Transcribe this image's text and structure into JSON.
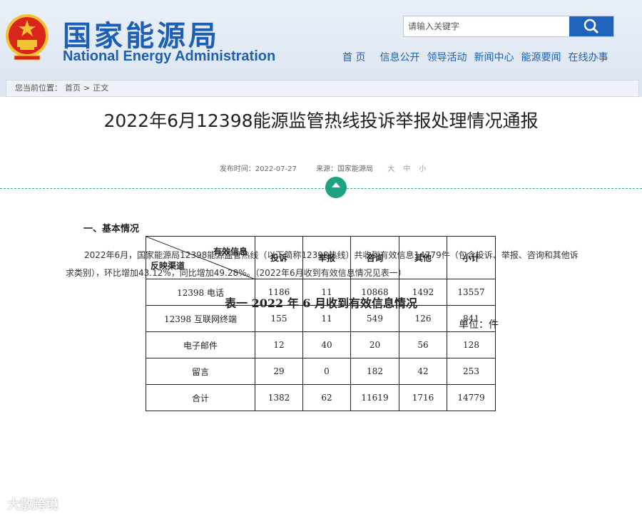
{
  "header": {
    "site_title": "国家能源局",
    "site_subtitle": "National Energy Administration",
    "search_placeholder": "请输入关键字",
    "nav": [
      "首 页",
      "信息公开",
      "领导活动",
      "新闻中心",
      "能源要闻",
      "在线办事"
    ]
  },
  "breadcrumb": {
    "label": "您当前位置：",
    "items": [
      "首页",
      "正文"
    ],
    "separator": ">"
  },
  "article": {
    "title": "2022年6月12398能源监管热线投诉举报处理情况通报",
    "publish_label": "发布时间：2022-07-27",
    "source_label": "来源：国家能源局",
    "size_options": [
      "大",
      "中",
      "小"
    ],
    "section_heading": "一、基本情况",
    "paragraph": "2022年6月，国家能源局12398能源监管热线（以下简称12398热线）共收到有效信息14779件（包含投诉、举报、咨询和其他诉求类别），环比增加43.12%，同比增加49.28%。（2022年6月收到有效信息情况见表一）",
    "table_caption": "表一  2022 年 6 月收到有效信息情况",
    "unit": "单位：件"
  },
  "table": {
    "header_diag_top": "有效信息",
    "header_diag_bottom": "反映渠道",
    "columns": [
      "投诉",
      "举报",
      "咨询",
      "其他",
      "小计"
    ],
    "rows": [
      {
        "channel": "12398 电话",
        "values": [
          "1186",
          "11",
          "10868",
          "1492",
          "13557"
        ]
      },
      {
        "channel": "12398 互联网终端",
        "values": [
          "155",
          "11",
          "549",
          "126",
          "841"
        ]
      },
      {
        "channel": "电子邮件",
        "values": [
          "12",
          "40",
          "20",
          "56",
          "128"
        ]
      },
      {
        "channel": "留言",
        "values": [
          "29",
          "0",
          "182",
          "42",
          "253"
        ]
      },
      {
        "channel": "合计",
        "values": [
          "1382",
          "62",
          "11619",
          "1716",
          "14779"
        ]
      }
    ]
  },
  "watermark": "大散跨境",
  "colors": {
    "brand_blue": "#1d5fb4",
    "search_button": "#1f63bb",
    "toggle_green": "#1ea285"
  }
}
